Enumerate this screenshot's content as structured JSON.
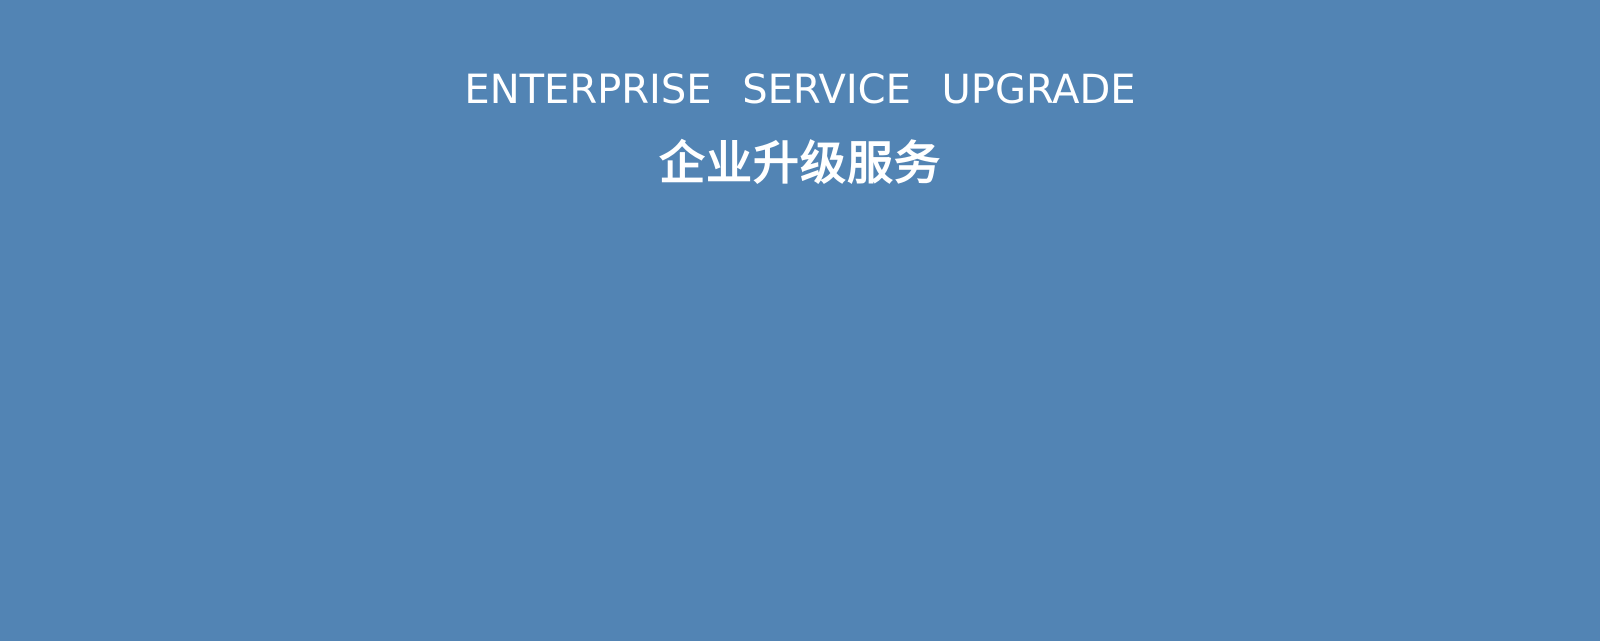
{
  "banner": {
    "background_color": "#5284b4",
    "text_color": "#ffffff",
    "title_en": "ENTERPRISE SERVICE UPGRADE",
    "title_cn": "企业升级服务"
  }
}
